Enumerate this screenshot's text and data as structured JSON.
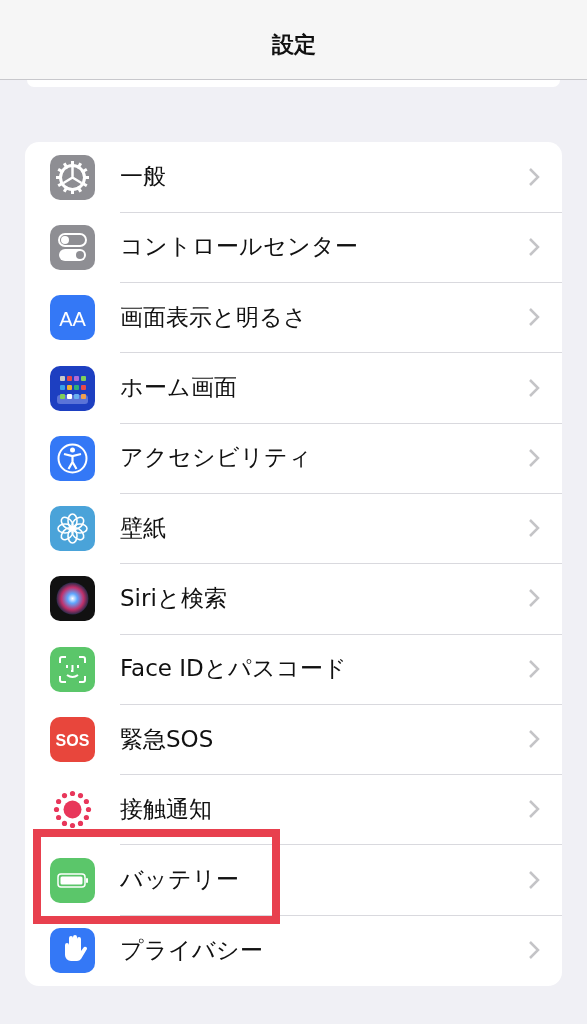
{
  "header": {
    "title": "設定"
  },
  "items": [
    {
      "label": "一般",
      "kind": "general",
      "highlighted": false
    },
    {
      "label": "コントロールセンター",
      "kind": "control",
      "highlighted": false
    },
    {
      "label": "画面表示と明るさ",
      "kind": "display",
      "icon_text": "AA",
      "highlighted": false
    },
    {
      "label": "ホーム画面",
      "kind": "home",
      "highlighted": false
    },
    {
      "label": "アクセシビリティ",
      "kind": "accessibility",
      "highlighted": false
    },
    {
      "label": "壁紙",
      "kind": "wallpaper",
      "highlighted": false
    },
    {
      "label": "Siriと検索",
      "kind": "siri",
      "highlighted": false
    },
    {
      "label": "Face IDとパスコード",
      "kind": "faceid",
      "highlighted": false
    },
    {
      "label": "緊急SOS",
      "kind": "sos",
      "icon_text": "SOS",
      "highlighted": false
    },
    {
      "label": "接触通知",
      "kind": "exposure",
      "highlighted": false
    },
    {
      "label": "バッテリー",
      "kind": "battery",
      "highlighted": true
    },
    {
      "label": "プライバシー",
      "kind": "privacy",
      "highlighted": false
    }
  ]
}
